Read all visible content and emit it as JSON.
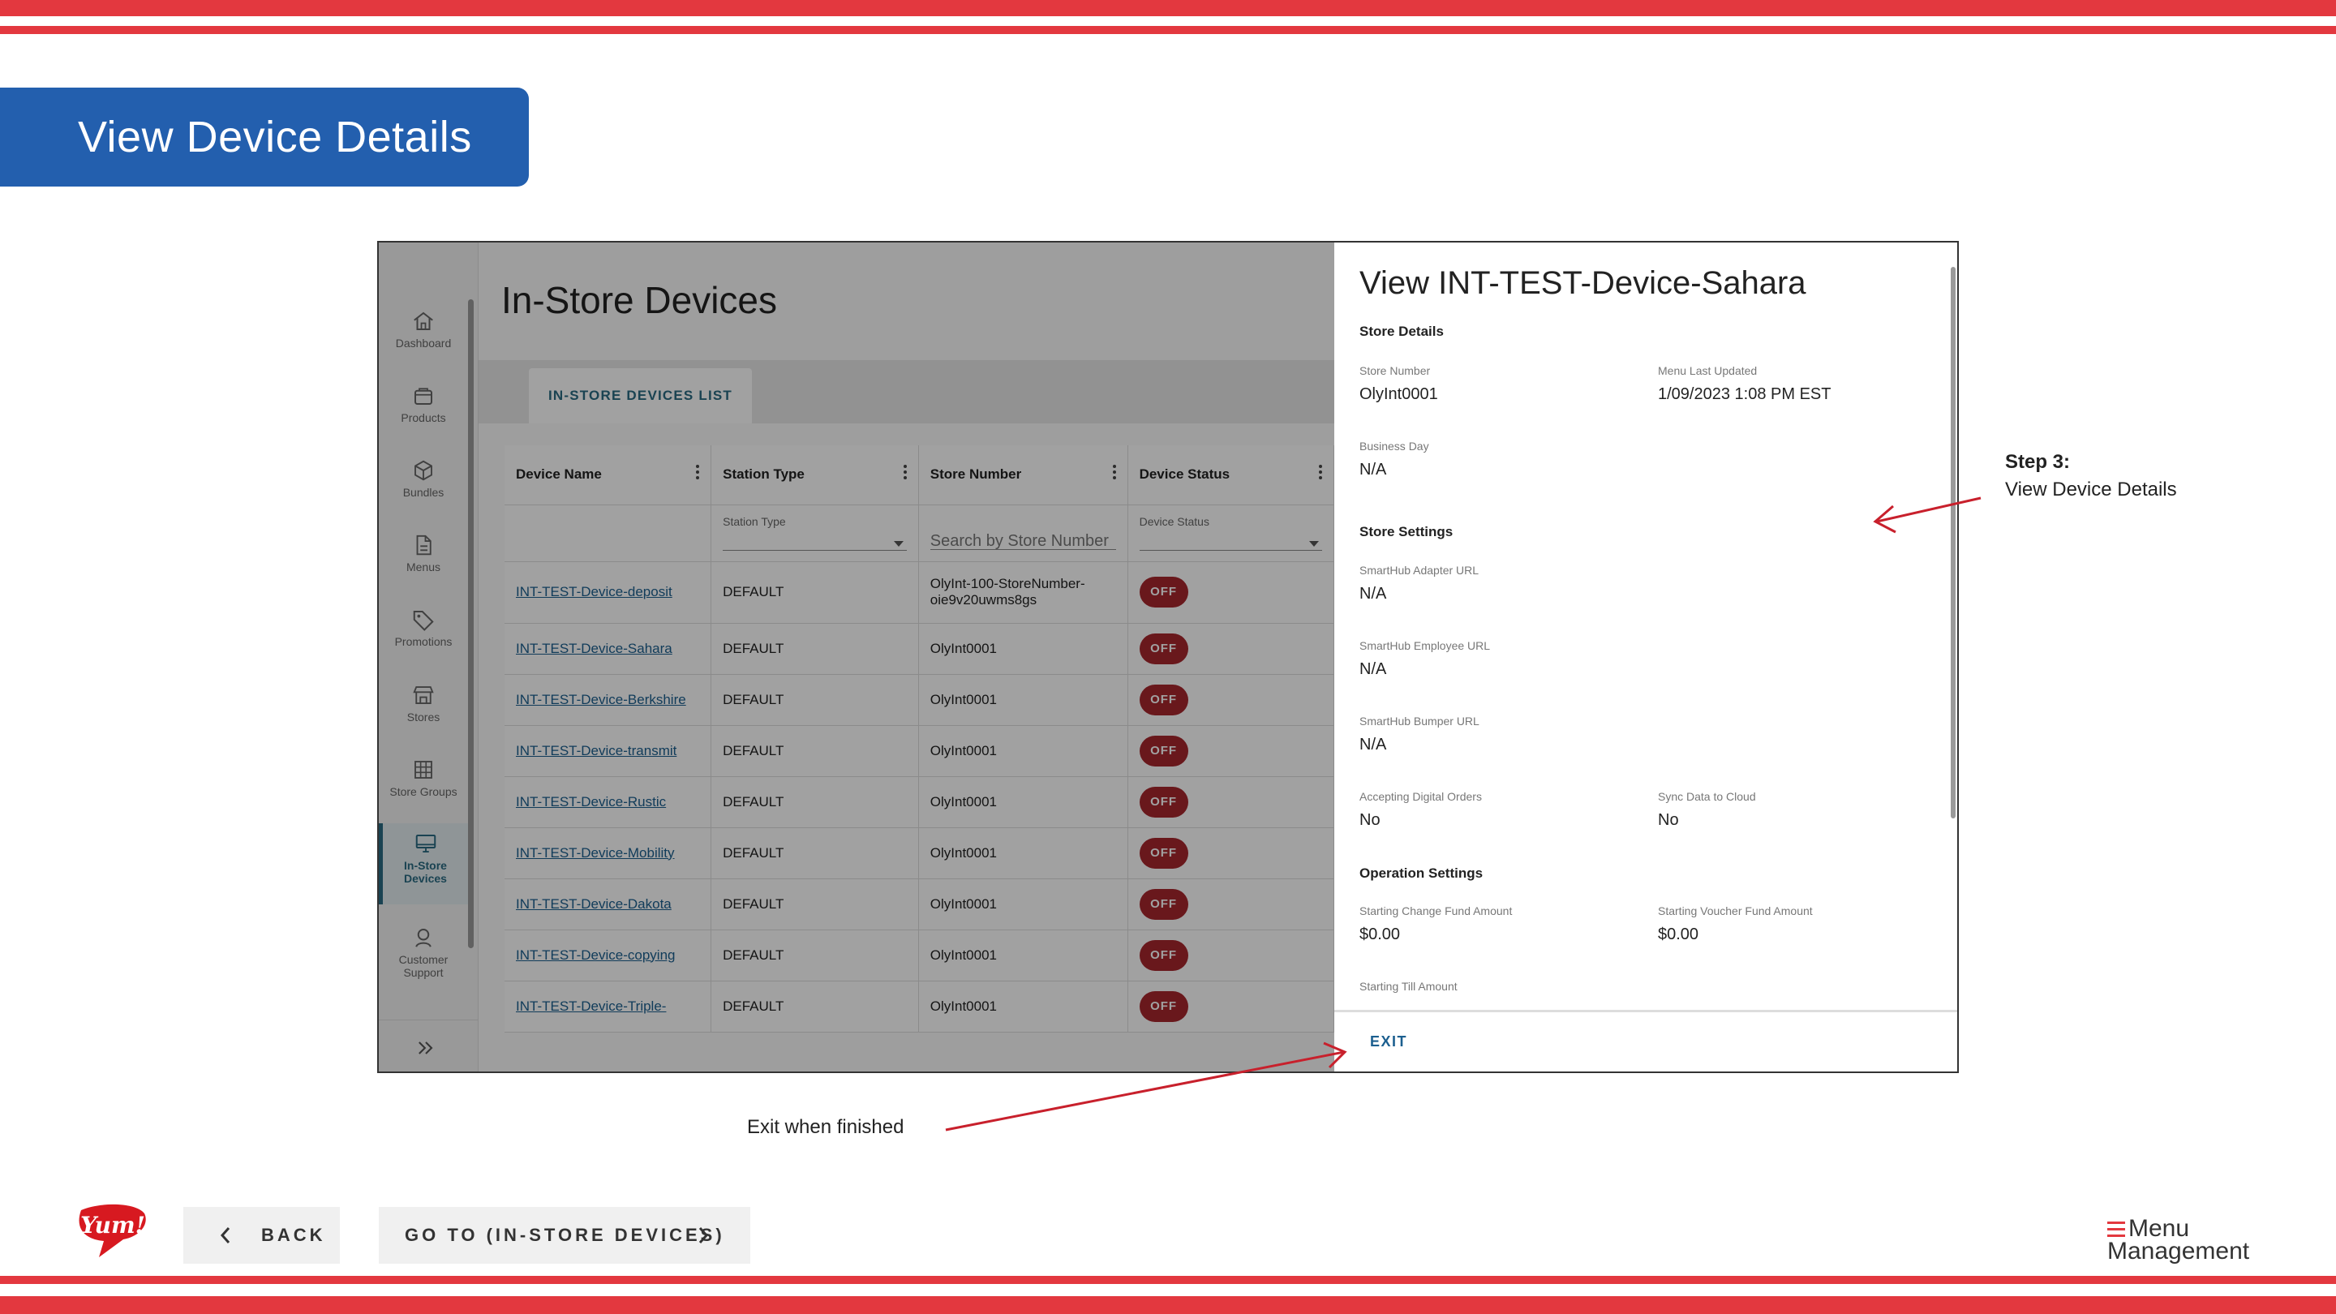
{
  "slide": {
    "title": "View Device Details",
    "step_annotation": {
      "title": "Step 3:",
      "text": "View Device Details"
    },
    "exit_annotation": "Exit when finished",
    "back_button": "BACK",
    "goto_button": "GO TO (IN-STORE DEVICES)",
    "brand_logo": "Yum!",
    "product_logo": {
      "line1": "Menu",
      "line2": "Management"
    },
    "accent_color": "#e3383f",
    "title_color": "#235fae"
  },
  "app": {
    "sidebar": [
      {
        "label": "Dashboard",
        "icon": "home-icon"
      },
      {
        "label": "Products",
        "icon": "bag-icon"
      },
      {
        "label": "Bundles",
        "icon": "box-icon"
      },
      {
        "label": "Menus",
        "icon": "document-icon"
      },
      {
        "label": "Promotions",
        "icon": "tag-icon"
      },
      {
        "label": "Stores",
        "icon": "storefront-icon"
      },
      {
        "label": "Store Groups",
        "icon": "grid-icon"
      },
      {
        "label": "In-Store Devices",
        "icon": "monitor-icon"
      },
      {
        "label": "Customer Support",
        "icon": "support-icon"
      }
    ],
    "page_title": "In-Store Devices",
    "tab": "IN-STORE DEVICES LIST",
    "table": {
      "headers": [
        "Device Name",
        "Station Type",
        "Store Number",
        "Device Status"
      ],
      "filters": {
        "station_type_label": "Station Type",
        "store_search_placeholder": "Search by Store Number",
        "device_status_label": "Device Status"
      },
      "rows": [
        {
          "name": "INT-TEST-Device-deposit",
          "station": "DEFAULT",
          "store": "OlyInt-100-StoreNumber-oie9v20uwms8gs",
          "status": "OFF"
        },
        {
          "name": "INT-TEST-Device-Sahara",
          "station": "DEFAULT",
          "store": "OlyInt0001",
          "status": "OFF"
        },
        {
          "name": "INT-TEST-Device-Berkshire",
          "station": "DEFAULT",
          "store": "OlyInt0001",
          "status": "OFF"
        },
        {
          "name": "INT-TEST-Device-transmit",
          "station": "DEFAULT",
          "store": "OlyInt0001",
          "status": "OFF"
        },
        {
          "name": "INT-TEST-Device-Rustic",
          "station": "DEFAULT",
          "store": "OlyInt0001",
          "status": "OFF"
        },
        {
          "name": "INT-TEST-Device-Mobility",
          "station": "DEFAULT",
          "store": "OlyInt0001",
          "status": "OFF"
        },
        {
          "name": "INT-TEST-Device-Dakota",
          "station": "DEFAULT",
          "store": "OlyInt0001",
          "status": "OFF"
        },
        {
          "name": "INT-TEST-Device-copying",
          "station": "DEFAULT",
          "store": "OlyInt0001",
          "status": "OFF"
        },
        {
          "name": "INT-TEST-Device-Triple-",
          "station": "DEFAULT",
          "store": "OlyInt0001",
          "status": "OFF"
        }
      ]
    }
  },
  "panel": {
    "title": "View INT-TEST-Device-Sahara",
    "store_details": {
      "heading": "Store Details",
      "store_number_label": "Store Number",
      "store_number": "OlyInt0001",
      "menu_updated_label": "Menu Last Updated",
      "menu_updated": "1/09/2023 1:08 PM EST",
      "business_day_label": "Business Day",
      "business_day": "N/A"
    },
    "store_settings": {
      "heading": "Store Settings",
      "adapter_label": "SmartHub Adapter URL",
      "adapter": "N/A",
      "employee_label": "SmartHub Employee URL",
      "employee": "N/A",
      "bumper_label": "SmartHub Bumper URL",
      "bumper": "N/A",
      "digital_label": "Accepting Digital Orders",
      "digital": "No",
      "sync_label": "Sync Data to Cloud",
      "sync": "No"
    },
    "operation_settings": {
      "heading": "Operation Settings",
      "change_fund_label": "Starting Change Fund Amount",
      "change_fund": "$0.00",
      "voucher_label": "Starting Voucher Fund Amount",
      "voucher": "$0.00",
      "till_label": "Starting Till Amount"
    },
    "exit_button": "EXIT"
  }
}
